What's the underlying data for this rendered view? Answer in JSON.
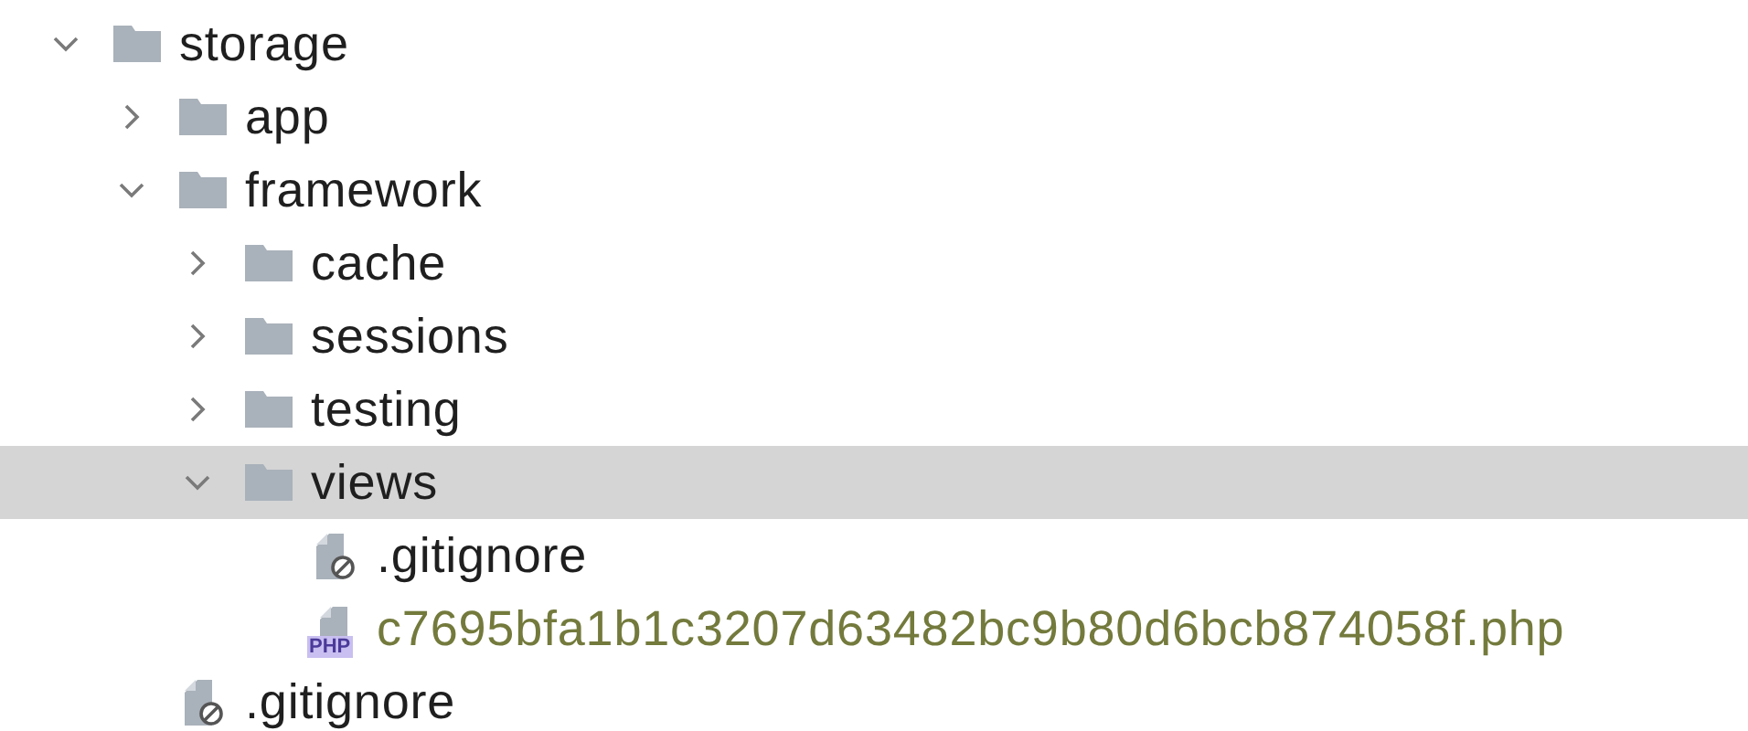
{
  "tree": [
    {
      "kind": "folder",
      "name": "storage",
      "expanded": true,
      "selected": false,
      "children": [
        {
          "kind": "folder",
          "name": "app",
          "expanded": false,
          "selected": false
        },
        {
          "kind": "folder",
          "name": "framework",
          "expanded": true,
          "selected": false,
          "children": [
            {
              "kind": "folder",
              "name": "cache",
              "expanded": false,
              "selected": false
            },
            {
              "kind": "folder",
              "name": "sessions",
              "expanded": false,
              "selected": false
            },
            {
              "kind": "folder",
              "name": "testing",
              "expanded": false,
              "selected": false
            },
            {
              "kind": "folder",
              "name": "views",
              "expanded": true,
              "selected": true,
              "children": [
                {
                  "kind": "ignored",
                  "name": ".gitignore",
                  "selected": false,
                  "color": "#1f1f1f"
                },
                {
                  "kind": "php",
                  "name": "c7695bfa1b1c3207d63482bc9b80d6bcb874058f.php",
                  "badge": "PHP",
                  "selected": false,
                  "color": "#737a3c"
                }
              ]
            }
          ]
        },
        {
          "kind": "ignored",
          "name": ".gitignore",
          "selected": false,
          "color": "#1f1f1f"
        }
      ]
    }
  ]
}
